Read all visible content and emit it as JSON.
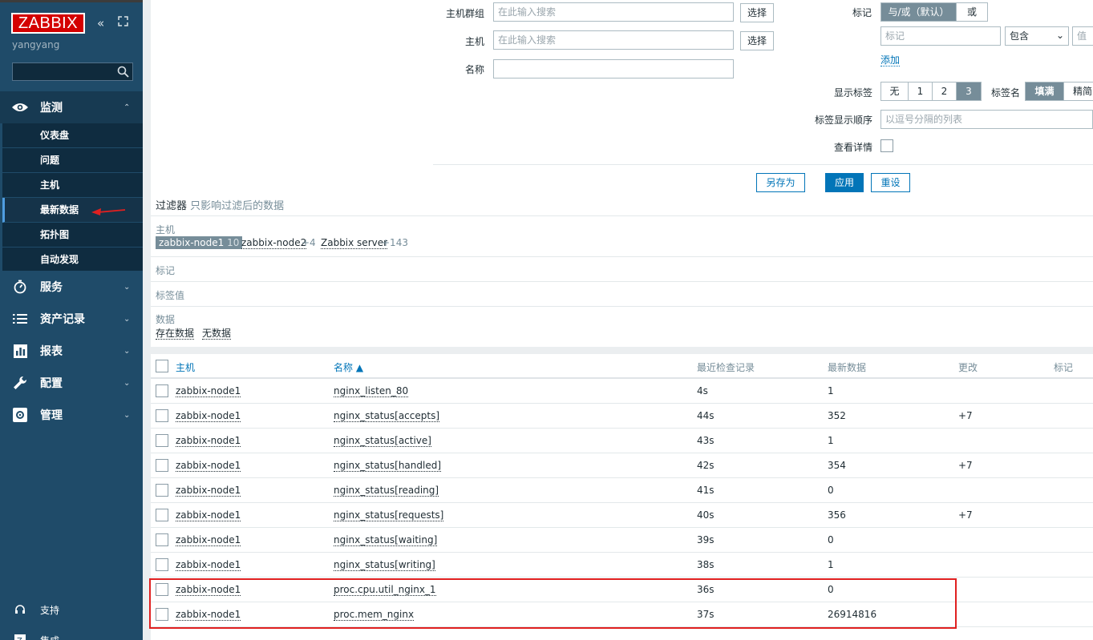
{
  "sidebar": {
    "logo": "ZABBIX",
    "username": "yangyang",
    "sections": {
      "monitoring": "监测",
      "services": "服务",
      "inventory": "资产记录",
      "reports": "报表",
      "config": "配置",
      "admin": "管理"
    },
    "submenu": [
      "仪表盘",
      "问题",
      "主机",
      "最新数据",
      "拓扑图",
      "自动发现"
    ],
    "bottom": {
      "support": "支持",
      "integrations": "集成"
    }
  },
  "filter": {
    "hostgroup_label": "主机群组",
    "host_label": "主机",
    "name_label": "名称",
    "search_placeholder": "在此输入搜索",
    "select_button": "选择",
    "tags_label": "标记",
    "andor_option": "与/或（默认）",
    "or_option": "或",
    "tag_placeholder": "标记",
    "operator_value": "包含",
    "value_placeholder": "值",
    "add_link": "添加",
    "show_tags_label": "显示标签",
    "show_tags_options": [
      "无",
      "1",
      "2",
      "3"
    ],
    "tag_name_label": "标签名",
    "tag_name_options": [
      "填满",
      "精简"
    ],
    "tag_order_label": "标签显示顺序",
    "tag_order_placeholder": "以逗号分隔的列表",
    "details_label": "查看详情",
    "save_as": "另存为",
    "apply": "应用",
    "reset": "重设"
  },
  "subfilter": {
    "title": "过滤器",
    "subtitle": "只影响过滤后的数据",
    "host_label": "主机",
    "hosts": [
      {
        "name": "zabbix-node1",
        "count": "10"
      },
      {
        "name": "zabbix-node2",
        "count": "+4"
      },
      {
        "name": "Zabbix server",
        "count": "+143"
      }
    ],
    "tags_label": "标记",
    "tag_values_label": "标签值",
    "data_label": "数据",
    "data_with": "存在数据",
    "data_without": "无数据"
  },
  "table": {
    "headers": {
      "host": "主机",
      "name": "名称 ▲",
      "last_check": "最近检查记录",
      "last_value": "最新数据",
      "change": "更改",
      "tags": "标记"
    },
    "rows": [
      {
        "host": "zabbix-node1",
        "name": "nginx_listen_80",
        "last_check": "4s",
        "last_value": "1",
        "change": ""
      },
      {
        "host": "zabbix-node1",
        "name": "nginx_status[accepts]",
        "last_check": "44s",
        "last_value": "352",
        "change": "+7"
      },
      {
        "host": "zabbix-node1",
        "name": "nginx_status[active]",
        "last_check": "43s",
        "last_value": "1",
        "change": ""
      },
      {
        "host": "zabbix-node1",
        "name": "nginx_status[handled]",
        "last_check": "42s",
        "last_value": "354",
        "change": "+7"
      },
      {
        "host": "zabbix-node1",
        "name": "nginx_status[reading]",
        "last_check": "41s",
        "last_value": "0",
        "change": ""
      },
      {
        "host": "zabbix-node1",
        "name": "nginx_status[requests]",
        "last_check": "40s",
        "last_value": "356",
        "change": "+7"
      },
      {
        "host": "zabbix-node1",
        "name": "nginx_status[waiting]",
        "last_check": "39s",
        "last_value": "0",
        "change": ""
      },
      {
        "host": "zabbix-node1",
        "name": "nginx_status[writing]",
        "last_check": "38s",
        "last_value": "1",
        "change": ""
      },
      {
        "host": "zabbix-node1",
        "name": "proc.cpu.util_nginx_1",
        "last_check": "36s",
        "last_value": "0",
        "change": ""
      },
      {
        "host": "zabbix-node1",
        "name": "proc.mem_nginx",
        "last_check": "37s",
        "last_value": "26914816",
        "change": ""
      }
    ]
  },
  "colors": {
    "sidebar_bg": "#1f4b69",
    "accent_blue": "#0275b8",
    "logo_red": "#d40000",
    "highlight_red": "#e02020"
  }
}
